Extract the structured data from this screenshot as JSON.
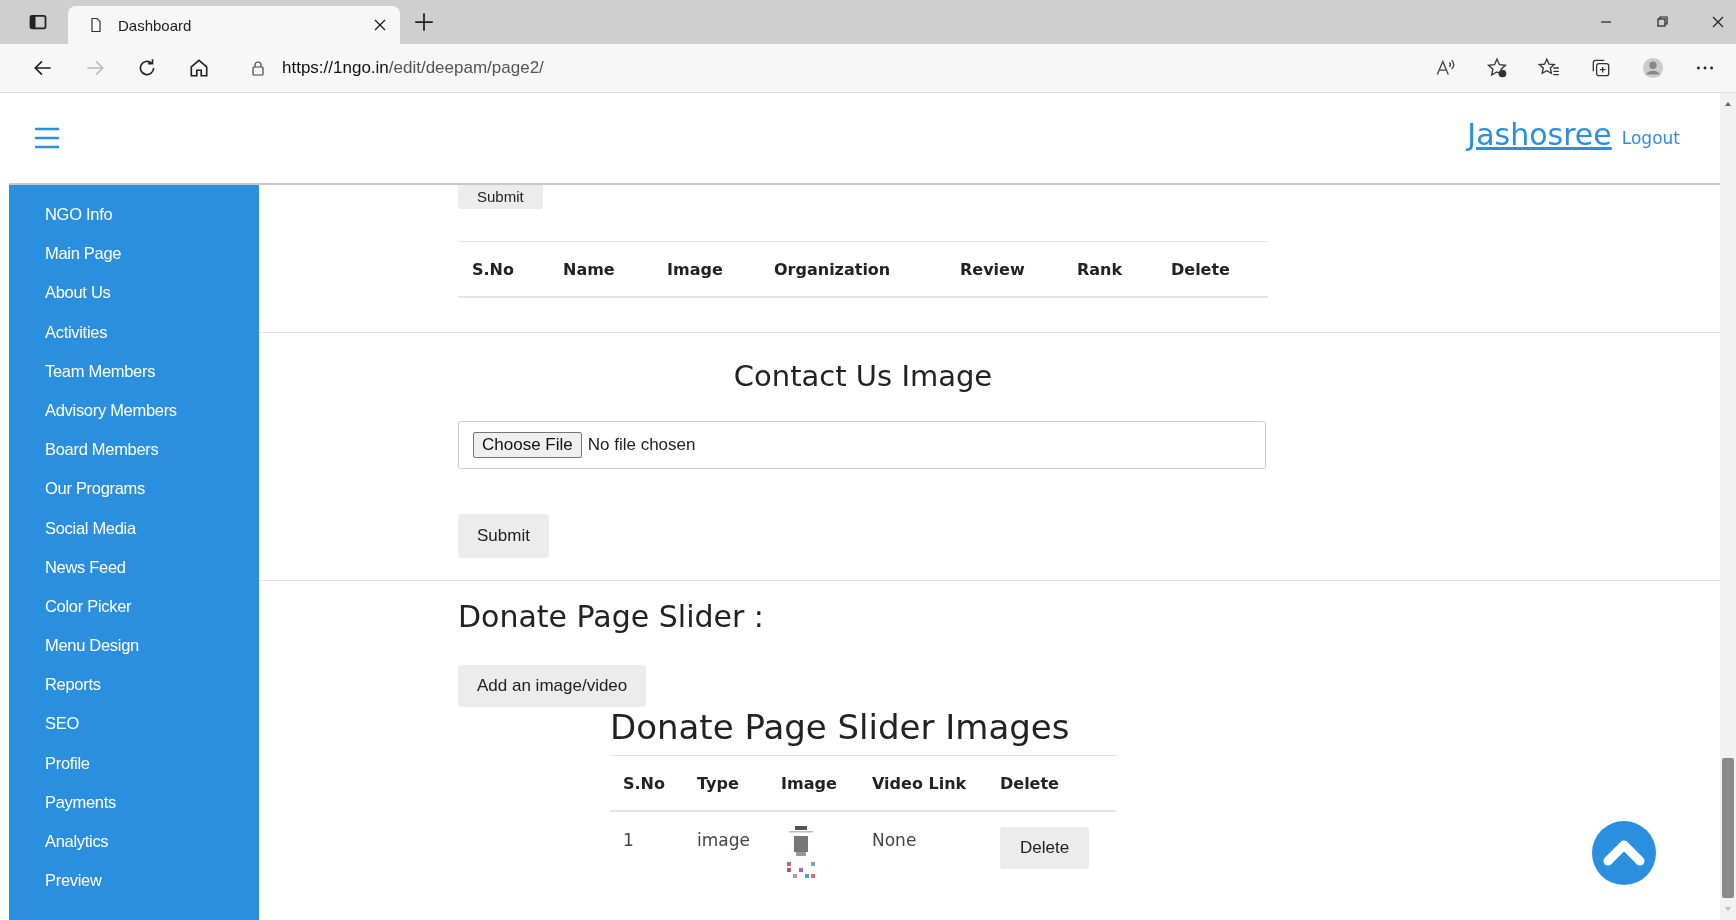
{
  "browser": {
    "tab_title": "Dashboard",
    "url_host": "https://1ngo.in",
    "url_path": "/edit/deepam/page2/"
  },
  "header": {
    "user": "Jashosree",
    "logout": "Logout"
  },
  "sidebar": {
    "items": [
      {
        "label": "NGO Info"
      },
      {
        "label": "Main Page"
      },
      {
        "label": "About Us"
      },
      {
        "label": "Activities"
      },
      {
        "label": "Team Members"
      },
      {
        "label": "Advisory Members"
      },
      {
        "label": "Board Members"
      },
      {
        "label": "Our Programs"
      },
      {
        "label": "Social Media"
      },
      {
        "label": "News Feed"
      },
      {
        "label": "Color Picker"
      },
      {
        "label": "Menu Design"
      },
      {
        "label": "Reports"
      },
      {
        "label": "SEO"
      },
      {
        "label": "Profile"
      },
      {
        "label": "Payments"
      },
      {
        "label": "Analytics"
      },
      {
        "label": "Preview"
      }
    ]
  },
  "top_submit": "Submit",
  "reviews_table": {
    "columns": [
      "S.No",
      "Name",
      "Image",
      "Organization",
      "Review",
      "Rank",
      "Delete"
    ]
  },
  "contact_image": {
    "title": "Contact Us Image",
    "file_button": "Choose File",
    "file_status": "No file chosen",
    "submit": "Submit"
  },
  "donate_slider": {
    "title": "Donate Page Slider :",
    "add_button": "Add an image/video",
    "table_title": "Donate Page Slider Images",
    "columns": [
      "S.No",
      "Type",
      "Image",
      "Video Link",
      "Delete"
    ],
    "rows": [
      {
        "sno": "1",
        "type": "image",
        "video_link": "None",
        "delete": "Delete"
      }
    ]
  }
}
